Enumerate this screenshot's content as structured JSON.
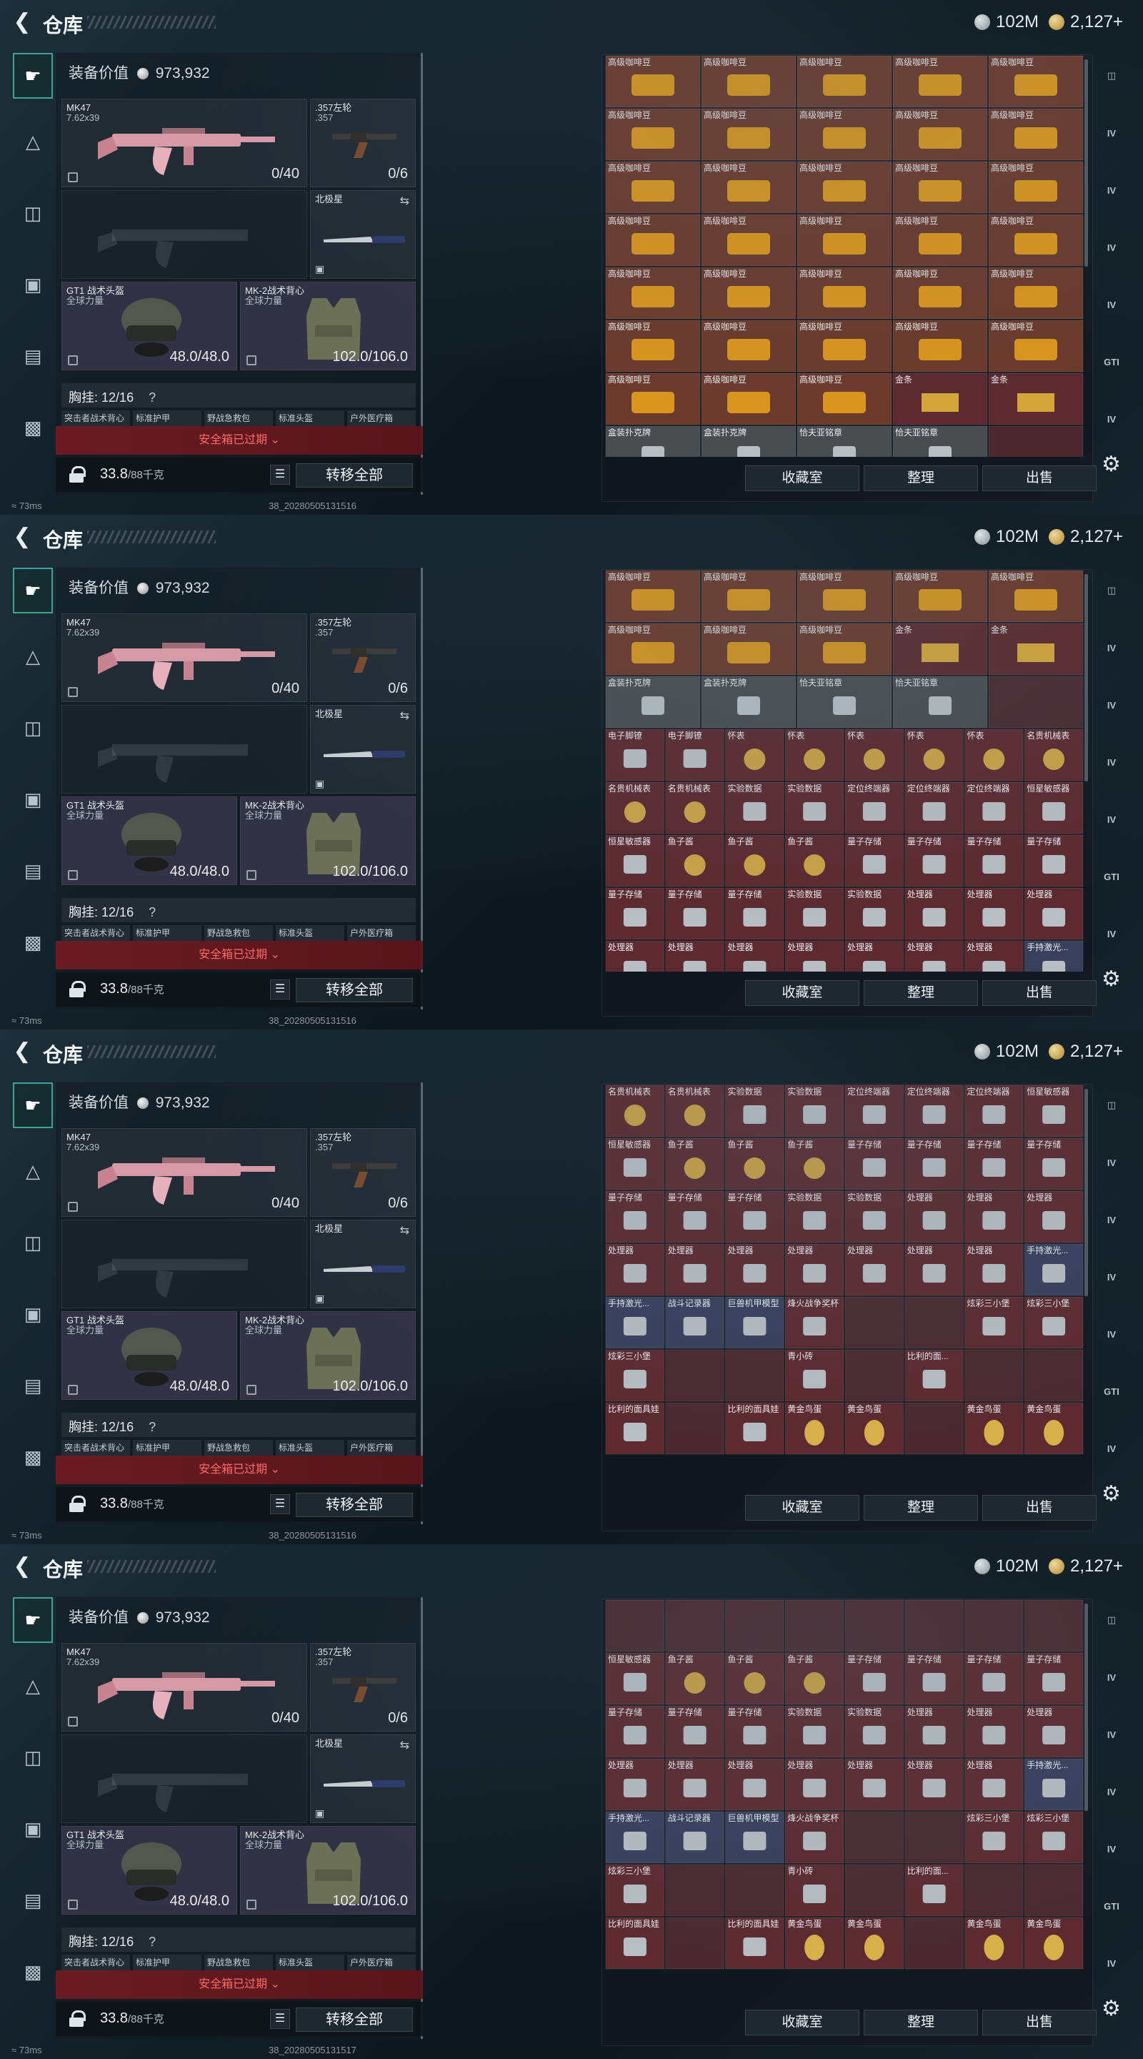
{
  "header": {
    "title": "仓库",
    "currency_silver": "102M",
    "currency_gold": "2,127+"
  },
  "equipment": {
    "value_label": "装备价值",
    "value": "973,932",
    "primary": {
      "name": "MK47",
      "caliber": "7.62x39",
      "ammo": "0/40"
    },
    "sidearm": {
      "name": ".357左轮",
      "caliber": ".357",
      "ammo": "0/6"
    },
    "melee": {
      "name": "北极星"
    },
    "helmet": {
      "name": "GT1 战术头盔",
      "brand": "全球力量",
      "durability": "48.0/48.0"
    },
    "vest": {
      "name": "MK-2战术背心",
      "brand": "全球力量",
      "durability": "102.0/106.0"
    },
    "chest_rig": {
      "label": "胸挂:",
      "value": "12/16",
      "help": "?"
    },
    "chest_items": [
      "突击者战术背心",
      "标准护甲",
      "野战急救包",
      "标准头盔",
      "户外医疗箱"
    ],
    "safe_box_banner": "安全箱已过期",
    "weight": "33.8",
    "weight_max": "/88千克",
    "transfer_all": "转移全部"
  },
  "status": {
    "ping": "73ms",
    "stamps": [
      "38_20280505131516",
      "38_20280505131516",
      "38_20280505131516",
      "38_20280505131517"
    ]
  },
  "storage": {
    "buttons": [
      "收藏室",
      "整理",
      "出售"
    ]
  },
  "right_tabs": [
    "IV",
    "IV",
    "IV",
    "IV",
    "GTI",
    "IV"
  ],
  "grids": [
    {
      "rows": [
        [
          "高级咖啡豆",
          "高级咖啡豆",
          "高级咖啡豆",
          "高级咖啡豆",
          "高级咖啡豆"
        ],
        [
          "高级咖啡豆",
          "高级咖啡豆",
          "高级咖啡豆",
          "高级咖啡豆",
          "高级咖啡豆"
        ],
        [
          "高级咖啡豆",
          "高级咖啡豆",
          "高级咖啡豆",
          "高级咖啡豆",
          "高级咖啡豆"
        ],
        [
          "高级咖啡豆",
          "高级咖啡豆",
          "高级咖啡豆",
          "高级咖啡豆",
          "高级咖啡豆"
        ],
        [
          "高级咖啡豆",
          "高级咖啡豆",
          "高级咖啡豆",
          "高级咖啡豆",
          "高级咖啡豆"
        ],
        [
          "高级咖啡豆",
          "高级咖啡豆",
          "高级咖啡豆",
          "高级咖啡豆",
          "高级咖啡豆"
        ],
        [
          "高级咖啡豆",
          "高级咖啡豆",
          "高级咖啡豆",
          "金条",
          "金条"
        ],
        [
          "盒装扑克牌",
          "盒装扑克牌",
          "恰夫亚铭章",
          "恰夫亚铭章",
          ""
        ]
      ]
    },
    {
      "rows": [
        [
          "高级咖啡豆",
          "高级咖啡豆",
          "高级咖啡豆",
          "高级咖啡豆",
          "高级咖啡豆"
        ],
        [
          "高级咖啡豆",
          "高级咖啡豆",
          "高级咖啡豆",
          "金条",
          "金条"
        ],
        [
          "盒装扑克牌",
          "盒装扑克牌",
          "恰夫亚铭章",
          "恰夫亚铭章",
          ""
        ],
        [
          "电子脚镣",
          "电子脚镣",
          "怀表",
          "怀表",
          "怀表",
          "怀表",
          "怀表",
          "名贵机械表"
        ],
        [
          "名贵机械表",
          "名贵机械表",
          "实验数据",
          "实验数据",
          "定位终端器",
          "定位终端器",
          "定位终端器",
          "恒星敏感器"
        ],
        [
          "恒星敏感器",
          "鱼子酱",
          "鱼子酱",
          "鱼子酱",
          "量子存储",
          "量子存储",
          "量子存储",
          "量子存储"
        ],
        [
          "量子存储",
          "量子存储",
          "量子存储",
          "实验数据",
          "实验数据",
          "处理器",
          "处理器",
          "处理器"
        ],
        [
          "处理器",
          "处理器",
          "处理器",
          "处理器",
          "处理器",
          "处理器",
          "处理器",
          "手持激光..."
        ]
      ]
    },
    {
      "rows": [
        [
          "名贵机械表",
          "名贵机械表",
          "实验数据",
          "实验数据",
          "定位终端器",
          "定位终端器",
          "定位终端器",
          "恒星敏感器"
        ],
        [
          "恒星敏感器",
          "鱼子酱",
          "鱼子酱",
          "鱼子酱",
          "量子存储",
          "量子存储",
          "量子存储",
          "量子存储"
        ],
        [
          "量子存储",
          "量子存储",
          "量子存储",
          "实验数据",
          "实验数据",
          "处理器",
          "处理器",
          "处理器"
        ],
        [
          "处理器",
          "处理器",
          "处理器",
          "处理器",
          "处理器",
          "处理器",
          "处理器",
          "手持激光..."
        ],
        [
          "手持激光...",
          "战斗记录器",
          "巨兽机甲模型",
          "烽火战争奖杯",
          "",
          "",
          "炫彩三小堡",
          "炫彩三小堡"
        ],
        [
          "炫彩三小堡",
          "",
          "",
          "青小砖",
          "",
          "比利的面...",
          "",
          ""
        ],
        [
          "比利的面具娃",
          "",
          "比利的面具娃",
          "黄金鸟蛋",
          "黄金鸟蛋",
          "",
          "黄金鸟蛋",
          "黄金鸟蛋"
        ]
      ]
    },
    {
      "rows": [
        [
          "",
          "",
          "",
          "",
          "",
          "",
          "",
          ""
        ],
        [
          "恒星敏感器",
          "鱼子酱",
          "鱼子酱",
          "鱼子酱",
          "量子存储",
          "量子存储",
          "量子存储",
          "量子存储"
        ],
        [
          "量子存储",
          "量子存储",
          "量子存储",
          "实验数据",
          "实验数据",
          "处理器",
          "处理器",
          "处理器"
        ],
        [
          "处理器",
          "处理器",
          "处理器",
          "处理器",
          "处理器",
          "处理器",
          "处理器",
          "手持激光..."
        ],
        [
          "手持激光...",
          "战斗记录器",
          "巨兽机甲模型",
          "烽火战争奖杯",
          "",
          "",
          "炫彩三小堡",
          "炫彩三小堡"
        ],
        [
          "炫彩三小堡",
          "",
          "",
          "青小砖",
          "",
          "比利的面...",
          "",
          ""
        ],
        [
          "比利的面具娃",
          "",
          "比利的面具娃",
          "黄金鸟蛋",
          "黄金鸟蛋",
          "",
          "黄金鸟蛋",
          "黄金鸟蛋"
        ]
      ]
    }
  ],
  "colors": {
    "cell_red": "#5c2a30",
    "cell_gold_bg": "#6b3a2c",
    "cell_blue": "#3a3f5c",
    "cell_gray": "#4a4d50",
    "accent_teal": "#3fa394",
    "warning_red": "#ff6a6a"
  },
  "icons": [
    "back-arrow-icon",
    "silver-coin-icon",
    "gold-coin-icon",
    "pistol-icon",
    "armor-icon",
    "bag-icon",
    "lock-icon",
    "list-icon",
    "gear-icon",
    "swap-icon"
  ]
}
